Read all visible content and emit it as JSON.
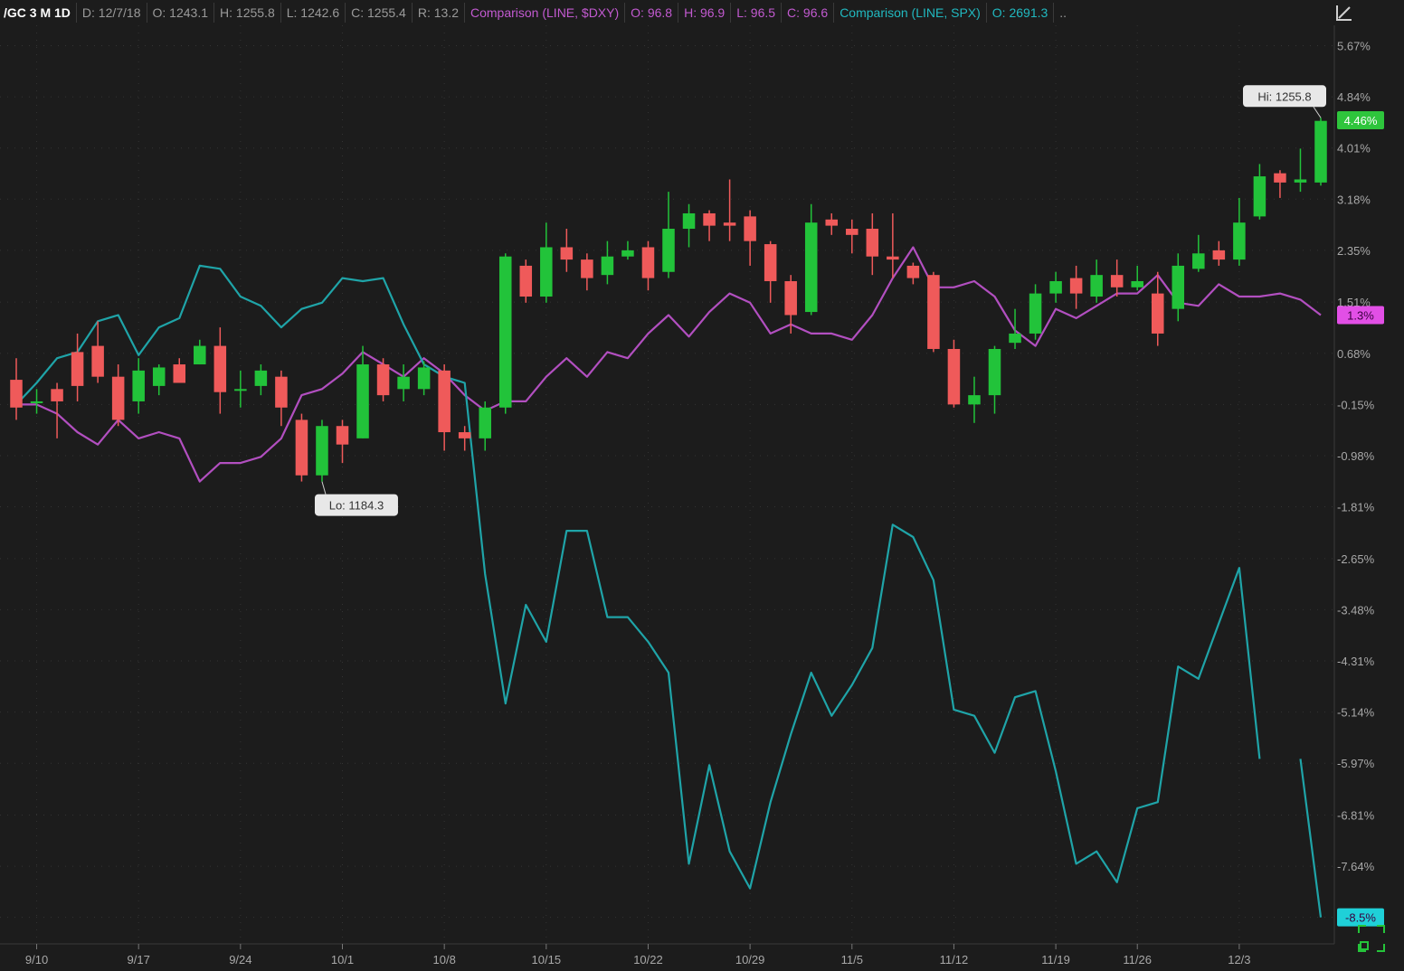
{
  "header": {
    "symbol": "/GC 3 M 1D",
    "date": "D: 12/7/18",
    "open": "O: 1243.1",
    "high": "H: 1255.8",
    "low": "L: 1242.6",
    "close": "C: 1255.4",
    "range": "R: 13.2",
    "dxy_label": "Comparison (LINE, $DXY)",
    "dxy_open": "O: 96.8",
    "dxy_high": "H: 96.9",
    "dxy_low": "L: 96.5",
    "dxy_close": "C: 96.6",
    "spx_label": "Comparison (LINE, SPX)",
    "spx_open": "O: 2691.3",
    "spx_more": ".."
  },
  "colors": {
    "background": "#1c1c1c",
    "grid": "#333333",
    "up": "#22c33a",
    "down": "#ef5a5a",
    "dxy": "#b24fc0",
    "spx": "#1fa4a8",
    "last_badge": "#2ec53c",
    "dxy_badge": "#e24fe6",
    "spx_badge": "#1fd0d8"
  },
  "chart_data": {
    "type": "candlestick",
    "unit": "% change",
    "y_ticks": [
      5.67,
      4.84,
      4.01,
      3.18,
      2.35,
      1.51,
      0.68,
      -0.15,
      -0.98,
      -1.81,
      -2.65,
      -3.48,
      -4.31,
      -5.14,
      -5.97,
      -6.81,
      -7.64,
      -8.47
    ],
    "y_tick_labels": [
      "5.67%",
      "4.84%",
      "4.01%",
      "3.18%",
      "2.35%",
      "1.51%",
      "0.68%",
      "-0.15%",
      "-0.98%",
      "-1.81%",
      "-2.65%",
      "-3.48%",
      "-4.31%",
      "-5.14%",
      "-5.97%",
      "-6.81%",
      "-7.64%",
      ""
    ],
    "ylim": [
      -8.9,
      6.0
    ],
    "x_tick_labels": [
      {
        "index": 1,
        "label": "9/10"
      },
      {
        "index": 6,
        "label": "9/17"
      },
      {
        "index": 11,
        "label": "9/24"
      },
      {
        "index": 16,
        "label": "10/1"
      },
      {
        "index": 21,
        "label": "10/8"
      },
      {
        "index": 26,
        "label": "10/15"
      },
      {
        "index": 31,
        "label": "10/22"
      },
      {
        "index": 36,
        "label": "10/29"
      },
      {
        "index": 41,
        "label": "11/5"
      },
      {
        "index": 46,
        "label": "11/12"
      },
      {
        "index": 51,
        "label": "11/19"
      },
      {
        "index": 55,
        "label": "11/26"
      },
      {
        "index": 60,
        "label": "12/3"
      }
    ],
    "candles": [
      [
        0.25,
        -0.2,
        0.6,
        -0.4
      ],
      [
        -0.1,
        -0.1,
        0.1,
        -0.3
      ],
      [
        0.1,
        -0.1,
        0.2,
        -0.7
      ],
      [
        0.7,
        0.15,
        1.0,
        -0.1
      ],
      [
        0.8,
        0.3,
        1.2,
        0.2
      ],
      [
        0.3,
        -0.4,
        0.5,
        -0.5
      ],
      [
        -0.1,
        0.4,
        0.6,
        -0.3
      ],
      [
        0.15,
        0.45,
        0.5,
        0.0
      ],
      [
        0.5,
        0.2,
        0.6,
        0.2
      ],
      [
        0.5,
        0.8,
        0.9,
        0.5
      ],
      [
        0.8,
        0.05,
        1.1,
        -0.3
      ],
      [
        0.1,
        0.1,
        0.4,
        -0.2
      ],
      [
        0.15,
        0.4,
        0.5,
        0.0
      ],
      [
        0.3,
        -0.2,
        0.4,
        -0.5
      ],
      [
        -0.4,
        -1.3,
        -0.3,
        -1.4
      ],
      [
        -1.3,
        -0.5,
        -0.4,
        -1.4
      ],
      [
        -0.5,
        -0.8,
        -0.4,
        -1.1
      ],
      [
        -0.7,
        0.5,
        0.8,
        -0.7
      ],
      [
        0.5,
        0.0,
        0.6,
        -0.1
      ],
      [
        0.1,
        0.3,
        0.5,
        -0.1
      ],
      [
        0.1,
        0.45,
        0.55,
        0.0
      ],
      [
        0.4,
        -0.6,
        0.5,
        -0.9
      ],
      [
        -0.6,
        -0.7,
        -0.5,
        -0.9
      ],
      [
        -0.7,
        -0.2,
        -0.1,
        -0.9
      ],
      [
        -0.2,
        2.25,
        2.3,
        -0.3
      ],
      [
        2.1,
        1.6,
        2.2,
        1.5
      ],
      [
        1.6,
        2.4,
        2.8,
        1.5
      ],
      [
        2.4,
        2.2,
        2.7,
        2.0
      ],
      [
        2.2,
        1.9,
        2.3,
        1.7
      ],
      [
        1.95,
        2.25,
        2.5,
        1.8
      ],
      [
        2.25,
        2.35,
        2.5,
        2.2
      ],
      [
        2.4,
        1.9,
        2.5,
        1.7
      ],
      [
        2.0,
        2.7,
        3.3,
        1.9
      ],
      [
        2.7,
        2.95,
        3.1,
        2.4
      ],
      [
        2.95,
        2.75,
        3.0,
        2.5
      ],
      [
        2.8,
        2.75,
        3.5,
        2.5
      ],
      [
        2.9,
        2.5,
        3.0,
        2.1
      ],
      [
        2.45,
        1.85,
        2.5,
        1.5
      ],
      [
        1.85,
        1.3,
        1.95,
        1.0
      ],
      [
        1.35,
        2.8,
        3.1,
        1.3
      ],
      [
        2.85,
        2.75,
        2.95,
        2.6
      ],
      [
        2.7,
        2.6,
        2.85,
        2.3
      ],
      [
        2.7,
        2.25,
        2.95,
        1.95
      ],
      [
        2.25,
        2.2,
        2.95,
        1.9
      ],
      [
        2.1,
        1.9,
        2.15,
        1.8
      ],
      [
        1.95,
        0.75,
        2.0,
        0.7
      ],
      [
        0.75,
        -0.15,
        0.9,
        -0.2
      ],
      [
        -0.15,
        0.0,
        0.3,
        -0.45
      ],
      [
        0.0,
        0.75,
        0.8,
        -0.3
      ],
      [
        0.85,
        1.0,
        1.4,
        0.75
      ],
      [
        1.0,
        1.65,
        1.8,
        0.9
      ],
      [
        1.65,
        1.85,
        2.0,
        1.5
      ],
      [
        1.9,
        1.65,
        2.1,
        1.4
      ],
      [
        1.6,
        1.95,
        2.2,
        1.5
      ],
      [
        1.95,
        1.75,
        2.2,
        1.6
      ],
      [
        1.75,
        1.85,
        2.1,
        1.7
      ],
      [
        1.65,
        1.0,
        2.0,
        0.8
      ],
      [
        1.4,
        2.1,
        2.3,
        1.2
      ],
      [
        2.05,
        2.3,
        2.6,
        2.0
      ],
      [
        2.35,
        2.2,
        2.5,
        2.1
      ],
      [
        2.2,
        2.8,
        3.2,
        2.1
      ],
      [
        2.9,
        3.55,
        3.75,
        2.85
      ],
      [
        3.6,
        3.45,
        3.65,
        3.2
      ],
      [
        3.45,
        3.5,
        4.0,
        3.3
      ],
      [
        3.45,
        4.45,
        4.5,
        3.4
      ]
    ],
    "series": [
      {
        "name": "Comparison (LINE, $DXY)",
        "values": [
          -0.15,
          -0.15,
          -0.3,
          -0.6,
          -0.8,
          -0.4,
          -0.7,
          -0.6,
          -0.7,
          -1.4,
          -1.1,
          -1.1,
          -1.0,
          -0.7,
          0.0,
          0.1,
          0.35,
          0.7,
          0.5,
          0.3,
          0.6,
          0.35,
          0.0,
          -0.25,
          -0.1,
          -0.1,
          0.3,
          0.6,
          0.3,
          0.7,
          0.6,
          1.0,
          1.3,
          0.95,
          1.35,
          1.65,
          1.5,
          1.0,
          1.15,
          1.0,
          1.0,
          0.9,
          1.3,
          1.9,
          2.4,
          1.75,
          1.75,
          1.85,
          1.6,
          1.05,
          0.8,
          1.4,
          1.25,
          1.45,
          1.65,
          1.65,
          1.95,
          1.5,
          1.45,
          1.8,
          1.6,
          1.6,
          1.65,
          1.55,
          1.3
        ]
      },
      {
        "name": "Comparison (LINE, SPX)",
        "values": [
          -0.15,
          0.2,
          0.6,
          0.7,
          1.2,
          1.3,
          0.65,
          1.1,
          1.25,
          2.1,
          2.05,
          1.6,
          1.45,
          1.1,
          1.4,
          1.5,
          1.9,
          1.85,
          1.9,
          1.15,
          0.5,
          0.3,
          0.2,
          -2.9,
          -5.0,
          -3.4,
          -4.0,
          -2.2,
          -2.2,
          -3.6,
          -3.6,
          -4.0,
          -4.5,
          -7.6,
          -6.0,
          -7.4,
          -8.0,
          -6.6,
          -5.5,
          -4.5,
          -5.2,
          -4.7,
          -4.1,
          -2.1,
          -2.3,
          -3.0,
          -5.1,
          -5.2,
          -5.8,
          -4.9,
          -4.8,
          -6.1,
          -7.6,
          -7.4,
          -7.9,
          -6.7,
          -6.6,
          -4.4,
          -4.6,
          -3.7,
          -2.8,
          -5.9,
          null,
          -5.9,
          -8.47
        ]
      }
    ],
    "annotations": [
      {
        "label": "Hi: 1255.8",
        "index": 64,
        "value": 4.5
      },
      {
        "label": "Lo: 1184.3",
        "index": 15,
        "value": -1.4
      }
    ],
    "badges": [
      {
        "label": "4.46%",
        "value": 4.46
      },
      {
        "label": "1.3%",
        "value": 1.3
      },
      {
        "label": "-8.5%",
        "value": -8.47
      }
    ]
  }
}
